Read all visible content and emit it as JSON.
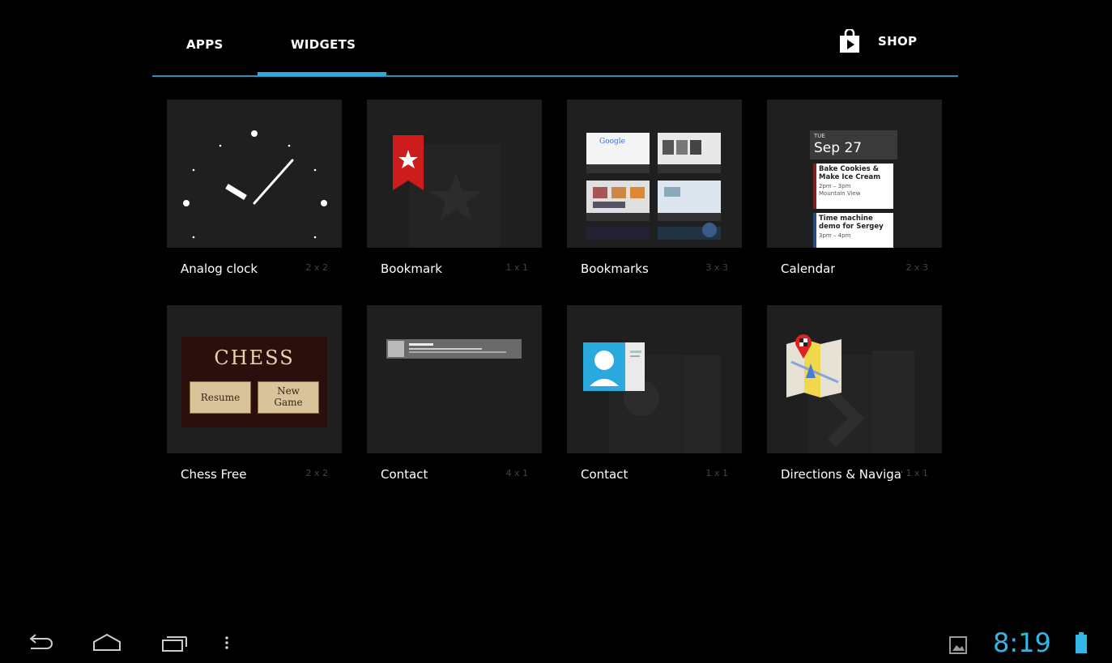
{
  "tabs": {
    "apps": "APPS",
    "widgets": "WIDGETS",
    "shop": "SHOP"
  },
  "widgets": [
    {
      "name": "Analog clock",
      "size": "2 x 2"
    },
    {
      "name": "Bookmark",
      "size": "1 x 1"
    },
    {
      "name": "Bookmarks",
      "size": "3 x 3"
    },
    {
      "name": "Calendar",
      "size": "2 x 3"
    },
    {
      "name": "Chess Free",
      "size": "2 x 2"
    },
    {
      "name": "Contact",
      "size": "4 x 1"
    },
    {
      "name": "Contact",
      "size": "1 x 1"
    },
    {
      "name": "Directions & Navigation",
      "size": "1 x 1"
    }
  ],
  "previews": {
    "google": "Google",
    "calendar": {
      "weekday": "TUE",
      "date": "Sep 27",
      "event1_title": "Bake Cookies & Make Ice Cream",
      "event1_time": "2pm – 3pm",
      "event1_place": "Mountain View",
      "event2_title": "Time machine demo for Sergey",
      "event2_time": "3pm – 4pm"
    },
    "chess": {
      "title": "CHESS",
      "resume": "Resume",
      "new_game_1": "New",
      "new_game_2": "Game"
    }
  },
  "status": {
    "time": "8:19"
  },
  "colors": {
    "accent": "#33b5e5",
    "tile_bg": "#1f1f1f"
  },
  "icons": [
    "back-icon",
    "home-icon",
    "recent-apps-icon",
    "menu-icon",
    "shop-bag-icon",
    "gallery-notification-icon",
    "battery-icon"
  ]
}
